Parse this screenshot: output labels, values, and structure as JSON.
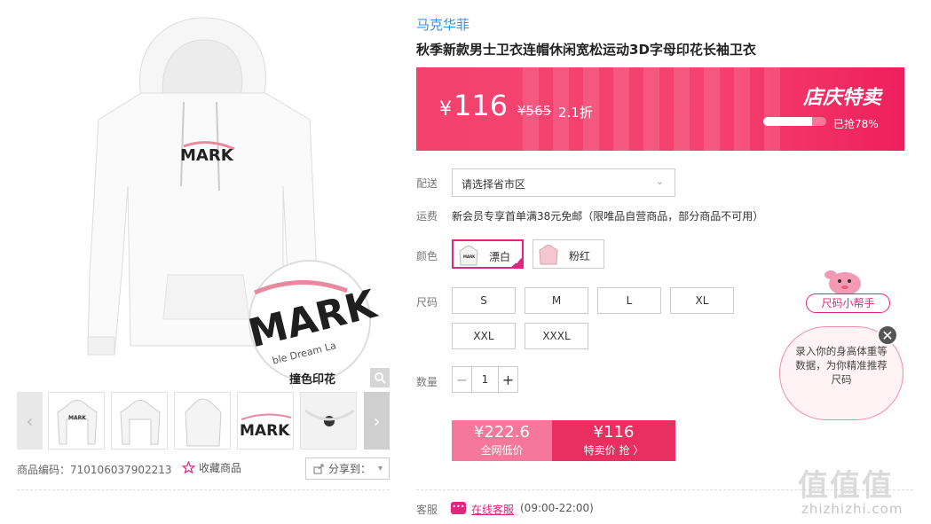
{
  "gallery": {
    "caption": "撞色印花",
    "main_logo": "MARK",
    "zoom_logo": "MARK",
    "zoom_slogan": "ble Dream La",
    "prev_arrow": "‹",
    "next_arrow": "›",
    "thumb_count": 6
  },
  "meta": {
    "product_code_label": "商品编码：",
    "product_code": "710106037902213",
    "favorite_label": "收藏商品",
    "share_label": "分享到：",
    "share_chevron": "▾"
  },
  "product": {
    "brand": "马克华菲",
    "title": "秋季新款男士卫衣连帽休闲宽松运动3D字母印花长袖卫衣"
  },
  "price_banner": {
    "currency": "¥",
    "current_price": "116",
    "original_price": "¥565",
    "discount": "2.1折",
    "promo_title": "店庆特卖",
    "sold_percent": 78,
    "sold_text": "已抢78%"
  },
  "delivery": {
    "label": "配送",
    "select_placeholder": "请选择省市区",
    "chevron": "⌄"
  },
  "shipping": {
    "label": "运费",
    "text": "新会员专享首单满38元免邮（限唯品自营商品，部分商品不可用）"
  },
  "color": {
    "label": "颜色",
    "options": [
      {
        "name": "漂白",
        "selected": true
      },
      {
        "name": "粉红",
        "selected": false
      }
    ],
    "check": "✓"
  },
  "size": {
    "label": "尺码",
    "options": [
      "S",
      "M",
      "L",
      "XL",
      "XXL",
      "XXXL"
    ]
  },
  "quantity": {
    "label": "数量",
    "value": "1",
    "minus": "−",
    "plus": "+"
  },
  "buy": {
    "market_price": "¥222.6",
    "market_label": "全网低价",
    "special_price": "¥116",
    "special_label": "特卖价 抢 〉"
  },
  "service": {
    "label": "客服",
    "icon_text": "•••",
    "link": "在线客服",
    "hours": "(09:00-22:00)"
  },
  "size_helper": {
    "tag": "尺码小帮手",
    "bubble_text": "录入你的身高体重等数据，为你精准推荐尺码",
    "close": "✕"
  },
  "watermark": {
    "brand": "值值值",
    "url": "zhizhizhi.com"
  },
  "colors": {
    "accent": "#e5247f",
    "banner": "#f2436e",
    "buy_left": "#f5779c",
    "buy_right": "#ea2f60",
    "brand_link": "#3a8ee6"
  }
}
